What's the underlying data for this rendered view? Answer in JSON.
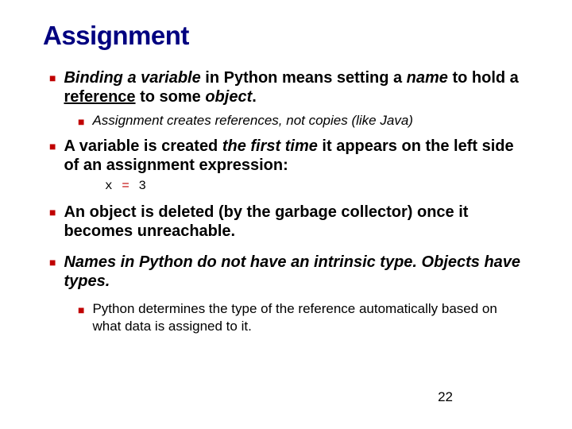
{
  "title": "Assignment",
  "bullets": {
    "b1_pre": "Binding a variable",
    "b1_mid1": " in Python means setting a ",
    "b1_em2": "name",
    "b1_mid2": " to hold a ",
    "b1_ul": "reference",
    "b1_mid3": " to some ",
    "b1_em3": "object",
    "b1_end": ".",
    "b1_sub": "Assignment creates references, not copies (like Java)",
    "b2_pre": "A variable is created ",
    "b2_em": "the first time",
    "b2_post": " it appears on the left side of an assignment expression:",
    "code_lhs": "x ",
    "code_op": "=",
    "code_rhs": " 3",
    "b3": "An object is deleted (by the garbage collector) once it becomes unreachable.",
    "b4_pre": "Names in Python do not have an intrinsic type. ",
    "b4_em": "Objects",
    "b4_post": " have types.",
    "b4_sub": "Python determines the type of the reference automatically based on what data is assigned to it."
  },
  "page_number": "22"
}
